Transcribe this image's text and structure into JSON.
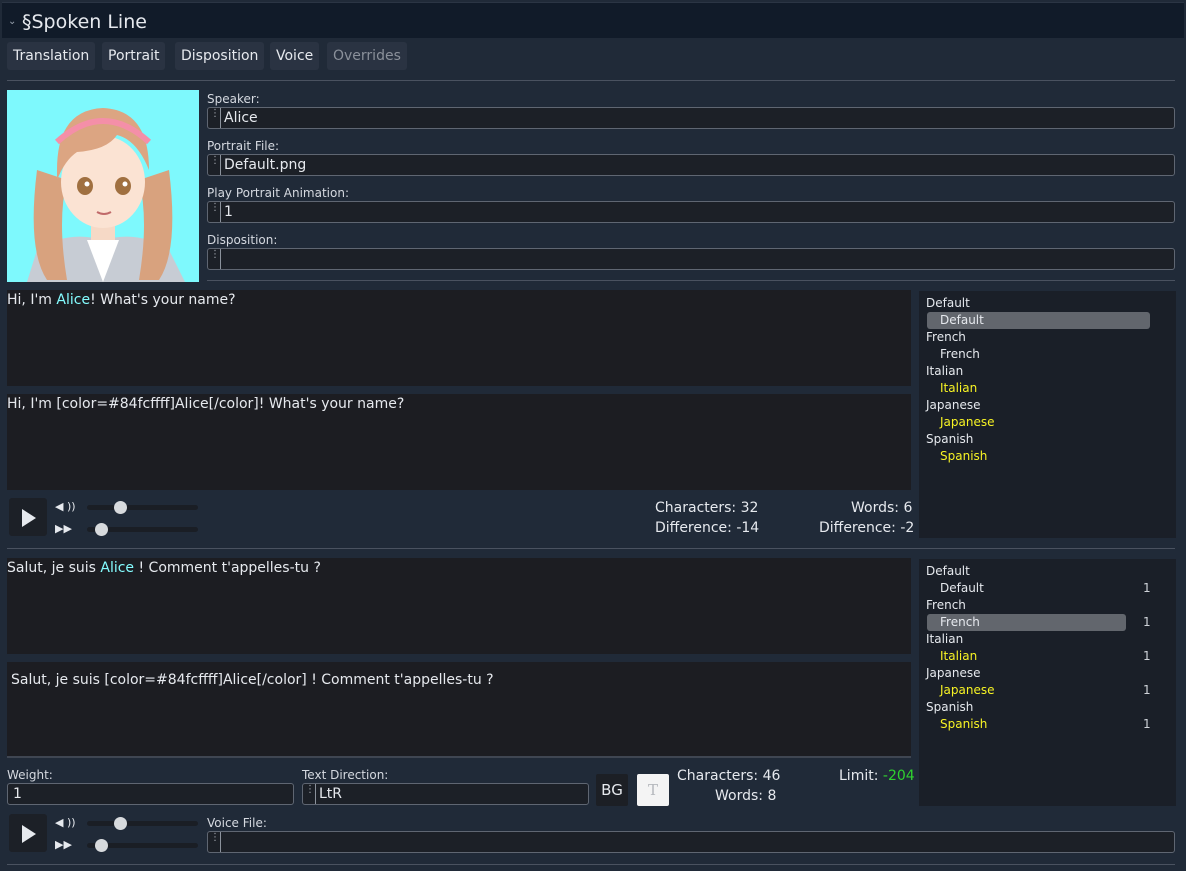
{
  "header": {
    "title": "§Spoken Line"
  },
  "tabs": [
    {
      "label": "Translation"
    },
    {
      "label": "Portrait"
    },
    {
      "label": "Disposition"
    },
    {
      "label": "Voice"
    },
    {
      "label": "Overrides"
    }
  ],
  "fields": {
    "speaker_label": "Speaker:",
    "speaker_value": "Alice",
    "portrait_file_label": "Portrait File:",
    "portrait_file_value": "Default.png",
    "play_anim_label": "Play Portrait Animation:",
    "play_anim_value": "1",
    "disposition_label": "Disposition:",
    "disposition_value": ""
  },
  "source": {
    "preview_before": "Hi, I'm ",
    "preview_name": "Alice",
    "preview_after": "! What's your name?",
    "raw_text": "Hi, I'm [color=#84fcffff]Alice[/color]! What's your name?",
    "characters_label": "Characters:",
    "characters_value": "32",
    "char_diff_label": "Difference:",
    "char_diff_value": "-14",
    "words_label": "Words:",
    "words_value": "6",
    "word_diff_label": "Difference:",
    "word_diff_value": "-2",
    "volume_icon": "◀ ))",
    "speed_icon": "▶▶",
    "volume_level": 0.24,
    "speed_level": 0.07
  },
  "source_list": [
    {
      "cat": "Default",
      "item": "Default",
      "selected": true,
      "color": "white"
    },
    {
      "cat": "French",
      "item": "French",
      "selected": false,
      "color": "white"
    },
    {
      "cat": "Italian",
      "item": "Italian",
      "selected": false,
      "color": "yellow"
    },
    {
      "cat": "Japanese",
      "item": "Japanese",
      "selected": false,
      "color": "yellow"
    },
    {
      "cat": "Spanish",
      "item": "Spanish",
      "selected": false,
      "color": "yellow"
    }
  ],
  "translation": {
    "preview_before": "Salut, je suis ",
    "preview_name": "Alice",
    "preview_after": " ! Comment t'appelles-tu ?",
    "raw_text": "Salut, je suis [color=#84fcffff]Alice[/color] ! Comment t'appelles-tu ?",
    "weight_label": "Weight:",
    "weight_value": "1",
    "text_direction_label": "Text Direction:",
    "text_direction_value": "LtR",
    "bg_button": "BG",
    "font_button": "T",
    "characters_label": "Characters:",
    "characters_value": "46",
    "words_label": "Words:",
    "words_value": "8",
    "limit_label": "Limit:",
    "limit_value": "-204",
    "voice_file_label": "Voice File:",
    "voice_file_value": "",
    "volume_icon": "◀ ))",
    "speed_icon": "▶▶",
    "volume_level": 0.24,
    "speed_level": 0.07
  },
  "translation_list": [
    {
      "cat": "Default",
      "item": "Default",
      "count": "1",
      "selected": false,
      "color": "white"
    },
    {
      "cat": "French",
      "item": "French",
      "count": "1",
      "selected": true,
      "color": "white"
    },
    {
      "cat": "Italian",
      "item": "Italian",
      "count": "1",
      "selected": false,
      "color": "yellow"
    },
    {
      "cat": "Japanese",
      "item": "Japanese",
      "count": "1",
      "selected": false,
      "color": "yellow"
    },
    {
      "cat": "Spanish",
      "item": "Spanish",
      "count": "1",
      "selected": false,
      "color": "yellow"
    }
  ],
  "colors": {
    "accent_cyan": "#84fcff",
    "limit_green": "#2fd12f",
    "yellow": "#f7f324",
    "portrait_bg": "#7ef9fd"
  }
}
